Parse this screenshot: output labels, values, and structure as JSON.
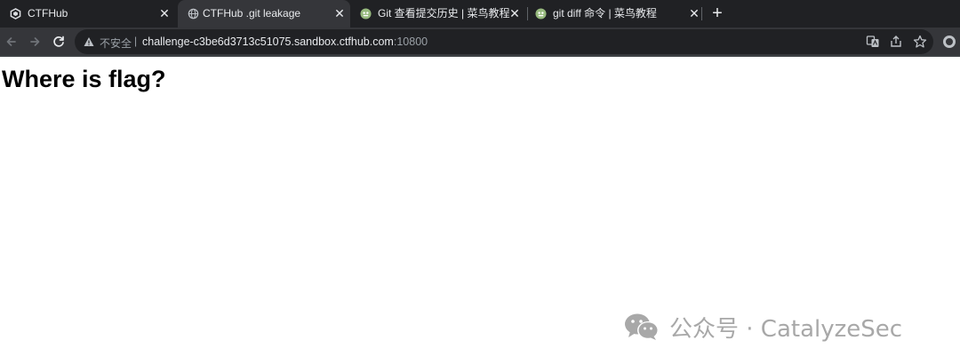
{
  "tabs": [
    {
      "title": "CTFHub",
      "favicon": "ctfhub-logo-icon",
      "active": false
    },
    {
      "title": "CTFHub .git leakage",
      "favicon": "globe-icon",
      "active": true
    },
    {
      "title": "Git 查看提交历史 | 菜鸟教程",
      "favicon": "runoob-logo-icon",
      "active": false
    },
    {
      "title": "git diff 命令 | 菜鸟教程",
      "favicon": "runoob-logo-icon",
      "active": false
    }
  ],
  "tab_close_glyph": "✕",
  "new_tab_glyph": "+",
  "address_bar": {
    "security_label": "不安全",
    "host": "challenge-c3be6d3713c51075.sandbox.ctfhub.com",
    "port": ":10800"
  },
  "page": {
    "heading": "Where is flag?"
  },
  "watermark": {
    "text": "公众号 · CatalyzeSec",
    "icon": "wechat-icon"
  },
  "colors": {
    "chrome_dark": "#202124",
    "chrome_active": "#35363a",
    "runoob_green": "#96b97d",
    "page_bg": "#ffffff"
  }
}
